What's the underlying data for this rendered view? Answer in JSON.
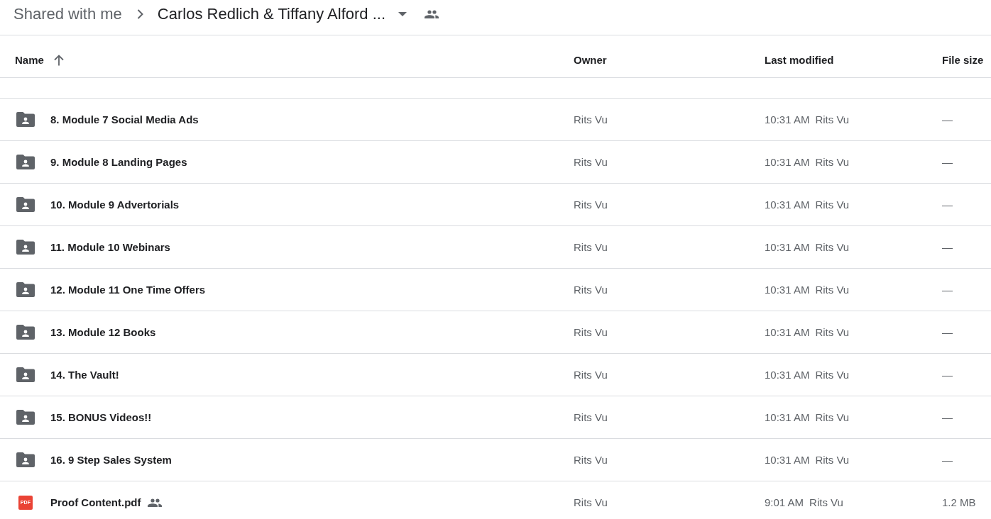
{
  "breadcrumb": [
    {
      "kind": "link",
      "label": "Shared with me"
    },
    {
      "kind": "current",
      "label": "Carlos Redlich & Tiffany Alford ...",
      "shared": true
    }
  ],
  "table": {
    "columns": [
      {
        "label": "Name",
        "sorted": true,
        "ascending": true
      },
      {
        "label": "Owner",
        "sorted": false
      },
      {
        "label": "Last modified",
        "sorted": false
      },
      {
        "label": "File size",
        "sorted": false
      }
    ],
    "rows": [
      {
        "kind": "shared_folder",
        "name": "8. Module 7 Social Media Ads",
        "shared": false,
        "owner": "Rits Vu",
        "modified": "10:31 AM",
        "modified_by": "Rits Vu",
        "file_size": "—"
      },
      {
        "kind": "shared_folder",
        "name": "9. Module 8 Landing Pages",
        "shared": false,
        "owner": "Rits Vu",
        "modified": "10:31 AM",
        "modified_by": "Rits Vu",
        "file_size": "—"
      },
      {
        "kind": "shared_folder",
        "name": "10. Module 9 Advertorials",
        "shared": false,
        "owner": "Rits Vu",
        "modified": "10:31 AM",
        "modified_by": "Rits Vu",
        "file_size": "—"
      },
      {
        "kind": "shared_folder",
        "name": "11. Module 10 Webinars",
        "shared": false,
        "owner": "Rits Vu",
        "modified": "10:31 AM",
        "modified_by": "Rits Vu",
        "file_size": "—"
      },
      {
        "kind": "shared_folder",
        "name": "12. Module 11 One Time Offers",
        "shared": false,
        "owner": "Rits Vu",
        "modified": "10:31 AM",
        "modified_by": "Rits Vu",
        "file_size": "—"
      },
      {
        "kind": "shared_folder",
        "name": "13. Module 12 Books",
        "shared": false,
        "owner": "Rits Vu",
        "modified": "10:31 AM",
        "modified_by": "Rits Vu",
        "file_size": "—"
      },
      {
        "kind": "shared_folder",
        "name": "14. The Vault!",
        "shared": false,
        "owner": "Rits Vu",
        "modified": "10:31 AM",
        "modified_by": "Rits Vu",
        "file_size": "—"
      },
      {
        "kind": "shared_folder",
        "name": "15. BONUS Videos!!",
        "shared": false,
        "owner": "Rits Vu",
        "modified": "10:31 AM",
        "modified_by": "Rits Vu",
        "file_size": "—"
      },
      {
        "kind": "shared_folder",
        "name": "16. 9 Step Sales System",
        "shared": false,
        "owner": "Rits Vu",
        "modified": "10:31 AM",
        "modified_by": "Rits Vu",
        "file_size": "—"
      },
      {
        "kind": "pdf",
        "type_label": "PDF",
        "name": "Proof Content.pdf",
        "shared": true,
        "owner": "Rits Vu",
        "modified": "9:01 AM",
        "modified_by": "Rits Vu",
        "file_size": "1.2 MB"
      }
    ]
  }
}
